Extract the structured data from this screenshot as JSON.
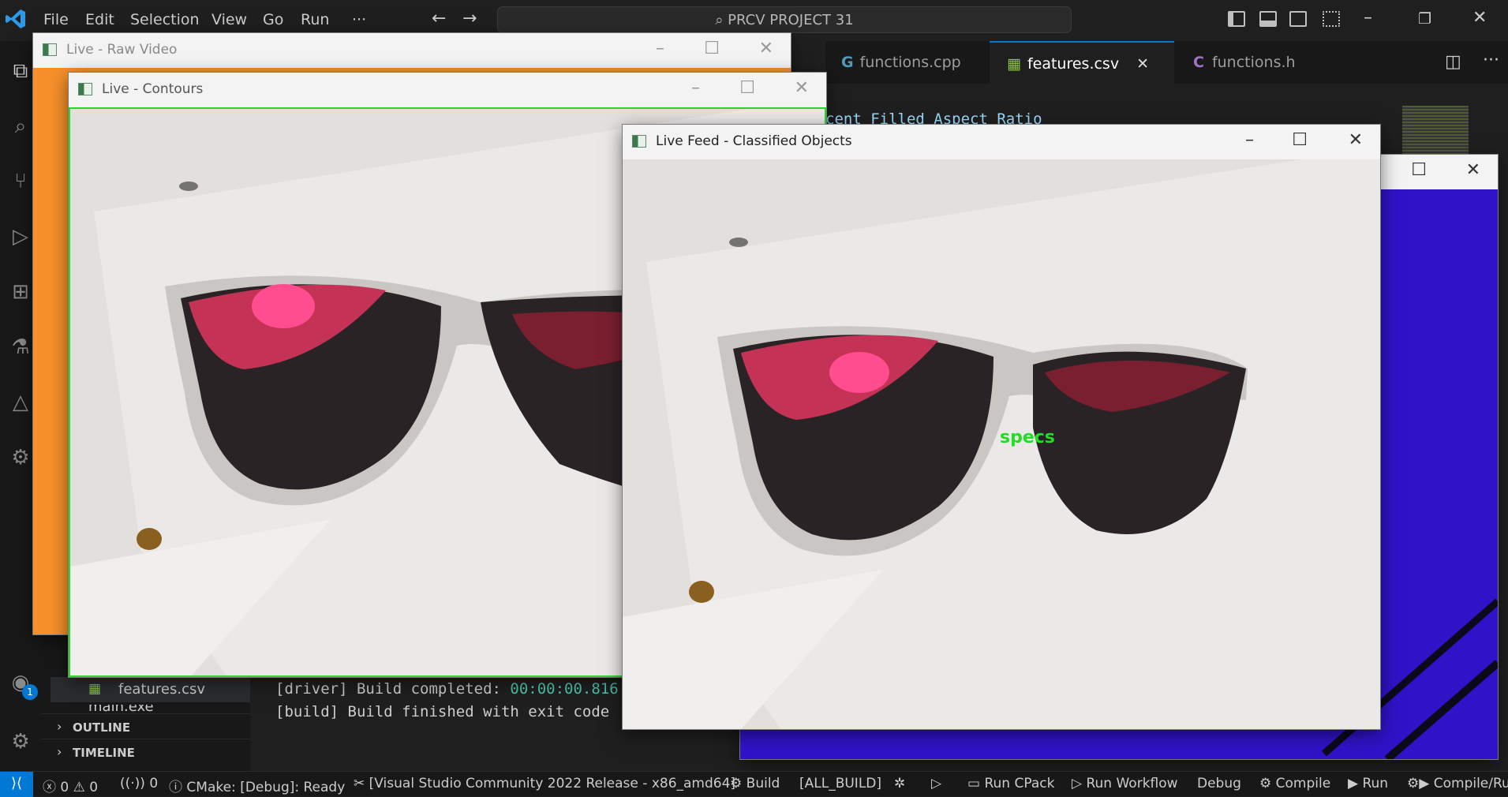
{
  "app": {
    "menu": [
      "File",
      "Edit",
      "Selection",
      "View",
      "Go",
      "Run",
      "···"
    ],
    "command_center": "PRCV PROJECT 31",
    "accent_color": "#0078d4"
  },
  "editor": {
    "tabs": [
      {
        "label": "functions.cpp",
        "icon": "cpp-file-icon"
      },
      {
        "label": "features.csv",
        "icon": "csv-file-icon",
        "active": true
      },
      {
        "label": "functions.h",
        "icon": "c-header-file-icon"
      }
    ],
    "visible_code": "cent Filled Aspect Ratio"
  },
  "sidebar": {
    "files": [
      "features.csv",
      "main.exe"
    ],
    "sections": [
      "OUTLINE",
      "TIMELINE"
    ]
  },
  "panel": {
    "lines": [
      {
        "prefix": "[driver] Build completed: ",
        "value": "00:00:00.816"
      },
      {
        "prefix": "[build] Build finished with exit code ",
        "value": ""
      }
    ]
  },
  "accounts_badge": "1",
  "statusbar": {
    "errors": "0",
    "warnings": "0",
    "ports": "0",
    "cmake": "CMake: [Debug]: Ready",
    "kit": "[Visual Studio Community 2022 Release - x86_amd64]",
    "build": "Build",
    "target": "[ALL_BUILD]",
    "run_cpack": "Run CPack",
    "run_workflow": "Run Workflow",
    "debug": "Debug",
    "compile": "Compile",
    "run": "Run",
    "compile_run": "Compile/Ru"
  },
  "windows": {
    "raw_video": {
      "title": "Live - Raw Video"
    },
    "contours": {
      "title": "Live - Contours"
    },
    "classified": {
      "title": "Live Feed - Classified Objects",
      "object_label": "specs",
      "label_color": "#22dd22"
    },
    "hidden_window": {
      "title": ""
    }
  }
}
